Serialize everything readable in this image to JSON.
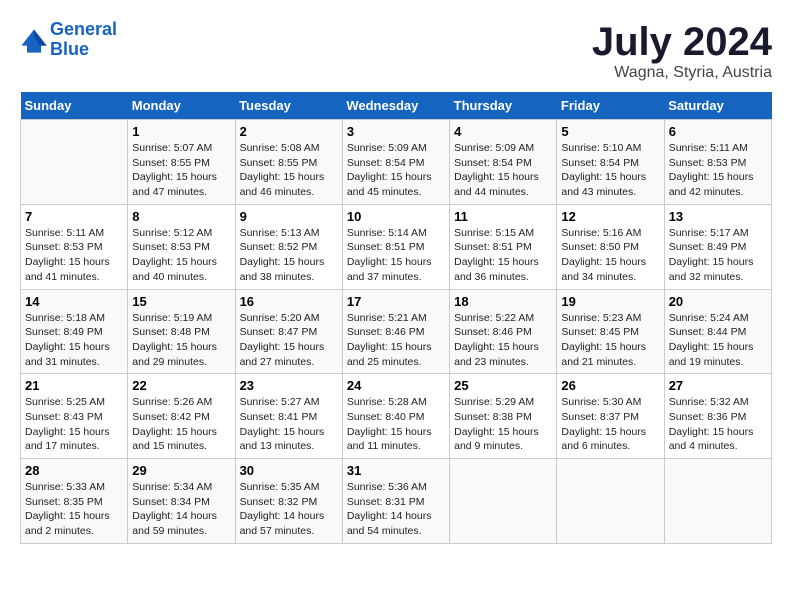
{
  "header": {
    "logo_line1": "General",
    "logo_line2": "Blue",
    "month": "July 2024",
    "location": "Wagna, Styria, Austria"
  },
  "days_of_week": [
    "Sunday",
    "Monday",
    "Tuesday",
    "Wednesday",
    "Thursday",
    "Friday",
    "Saturday"
  ],
  "weeks": [
    [
      {
        "day": "",
        "info": ""
      },
      {
        "day": "1",
        "info": "Sunrise: 5:07 AM\nSunset: 8:55 PM\nDaylight: 15 hours\nand 47 minutes."
      },
      {
        "day": "2",
        "info": "Sunrise: 5:08 AM\nSunset: 8:55 PM\nDaylight: 15 hours\nand 46 minutes."
      },
      {
        "day": "3",
        "info": "Sunrise: 5:09 AM\nSunset: 8:54 PM\nDaylight: 15 hours\nand 45 minutes."
      },
      {
        "day": "4",
        "info": "Sunrise: 5:09 AM\nSunset: 8:54 PM\nDaylight: 15 hours\nand 44 minutes."
      },
      {
        "day": "5",
        "info": "Sunrise: 5:10 AM\nSunset: 8:54 PM\nDaylight: 15 hours\nand 43 minutes."
      },
      {
        "day": "6",
        "info": "Sunrise: 5:11 AM\nSunset: 8:53 PM\nDaylight: 15 hours\nand 42 minutes."
      }
    ],
    [
      {
        "day": "7",
        "info": "Sunrise: 5:11 AM\nSunset: 8:53 PM\nDaylight: 15 hours\nand 41 minutes."
      },
      {
        "day": "8",
        "info": "Sunrise: 5:12 AM\nSunset: 8:53 PM\nDaylight: 15 hours\nand 40 minutes."
      },
      {
        "day": "9",
        "info": "Sunrise: 5:13 AM\nSunset: 8:52 PM\nDaylight: 15 hours\nand 38 minutes."
      },
      {
        "day": "10",
        "info": "Sunrise: 5:14 AM\nSunset: 8:51 PM\nDaylight: 15 hours\nand 37 minutes."
      },
      {
        "day": "11",
        "info": "Sunrise: 5:15 AM\nSunset: 8:51 PM\nDaylight: 15 hours\nand 36 minutes."
      },
      {
        "day": "12",
        "info": "Sunrise: 5:16 AM\nSunset: 8:50 PM\nDaylight: 15 hours\nand 34 minutes."
      },
      {
        "day": "13",
        "info": "Sunrise: 5:17 AM\nSunset: 8:49 PM\nDaylight: 15 hours\nand 32 minutes."
      }
    ],
    [
      {
        "day": "14",
        "info": "Sunrise: 5:18 AM\nSunset: 8:49 PM\nDaylight: 15 hours\nand 31 minutes."
      },
      {
        "day": "15",
        "info": "Sunrise: 5:19 AM\nSunset: 8:48 PM\nDaylight: 15 hours\nand 29 minutes."
      },
      {
        "day": "16",
        "info": "Sunrise: 5:20 AM\nSunset: 8:47 PM\nDaylight: 15 hours\nand 27 minutes."
      },
      {
        "day": "17",
        "info": "Sunrise: 5:21 AM\nSunset: 8:46 PM\nDaylight: 15 hours\nand 25 minutes."
      },
      {
        "day": "18",
        "info": "Sunrise: 5:22 AM\nSunset: 8:46 PM\nDaylight: 15 hours\nand 23 minutes."
      },
      {
        "day": "19",
        "info": "Sunrise: 5:23 AM\nSunset: 8:45 PM\nDaylight: 15 hours\nand 21 minutes."
      },
      {
        "day": "20",
        "info": "Sunrise: 5:24 AM\nSunset: 8:44 PM\nDaylight: 15 hours\nand 19 minutes."
      }
    ],
    [
      {
        "day": "21",
        "info": "Sunrise: 5:25 AM\nSunset: 8:43 PM\nDaylight: 15 hours\nand 17 minutes."
      },
      {
        "day": "22",
        "info": "Sunrise: 5:26 AM\nSunset: 8:42 PM\nDaylight: 15 hours\nand 15 minutes."
      },
      {
        "day": "23",
        "info": "Sunrise: 5:27 AM\nSunset: 8:41 PM\nDaylight: 15 hours\nand 13 minutes."
      },
      {
        "day": "24",
        "info": "Sunrise: 5:28 AM\nSunset: 8:40 PM\nDaylight: 15 hours\nand 11 minutes."
      },
      {
        "day": "25",
        "info": "Sunrise: 5:29 AM\nSunset: 8:38 PM\nDaylight: 15 hours\nand 9 minutes."
      },
      {
        "day": "26",
        "info": "Sunrise: 5:30 AM\nSunset: 8:37 PM\nDaylight: 15 hours\nand 6 minutes."
      },
      {
        "day": "27",
        "info": "Sunrise: 5:32 AM\nSunset: 8:36 PM\nDaylight: 15 hours\nand 4 minutes."
      }
    ],
    [
      {
        "day": "28",
        "info": "Sunrise: 5:33 AM\nSunset: 8:35 PM\nDaylight: 15 hours\nand 2 minutes."
      },
      {
        "day": "29",
        "info": "Sunrise: 5:34 AM\nSunset: 8:34 PM\nDaylight: 14 hours\nand 59 minutes."
      },
      {
        "day": "30",
        "info": "Sunrise: 5:35 AM\nSunset: 8:32 PM\nDaylight: 14 hours\nand 57 minutes."
      },
      {
        "day": "31",
        "info": "Sunrise: 5:36 AM\nSunset: 8:31 PM\nDaylight: 14 hours\nand 54 minutes."
      },
      {
        "day": "",
        "info": ""
      },
      {
        "day": "",
        "info": ""
      },
      {
        "day": "",
        "info": ""
      }
    ]
  ]
}
